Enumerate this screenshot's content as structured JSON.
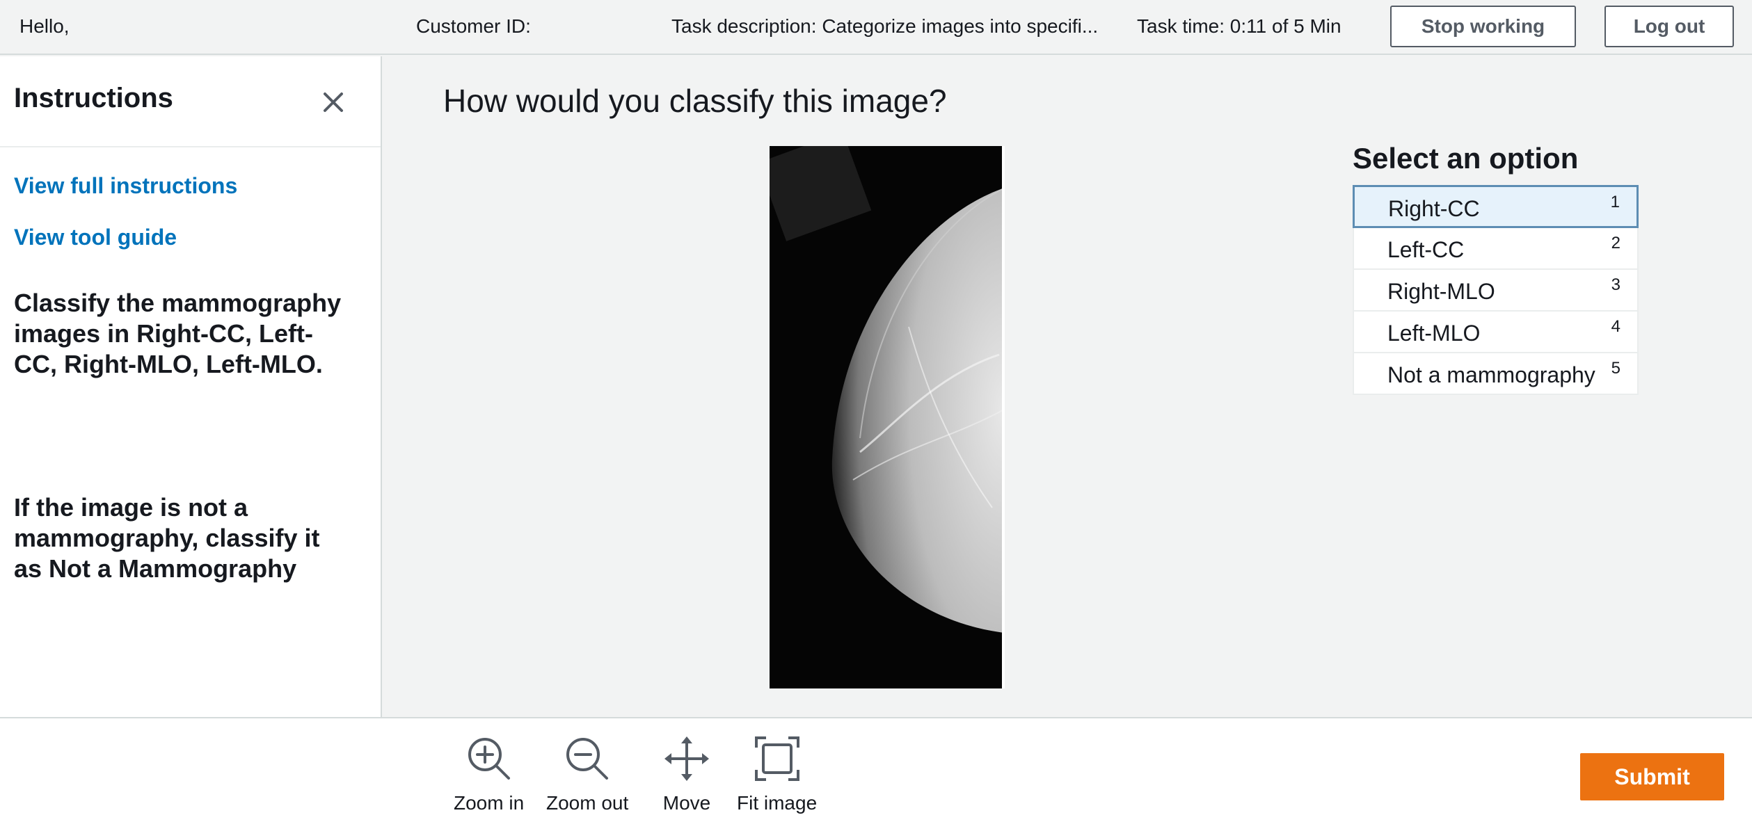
{
  "header": {
    "greeting": "Hello,",
    "customer_id_label": "Customer ID:",
    "task_description": "Task description: Categorize images into specifi...",
    "task_time": "Task time: 0:11 of 5 Min",
    "stop_button": "Stop working",
    "logout_button": "Log out"
  },
  "sidebar": {
    "title": "Instructions",
    "links": [
      "View full instructions",
      "View tool guide"
    ],
    "instruction_1": "Classify the mammography images in Right-CC, Left-CC, Right-MLO, Left-MLO.",
    "instruction_2": "If the image is not a mammography, classify it as Not a Mammography"
  },
  "main": {
    "question": "How would you classify this image?",
    "options_title": "Select an option",
    "options": [
      {
        "label": "Right-CC",
        "key": "1",
        "selected": true
      },
      {
        "label": "Left-CC",
        "key": "2",
        "selected": false
      },
      {
        "label": "Right-MLO",
        "key": "3",
        "selected": false
      },
      {
        "label": "Left-MLO",
        "key": "4",
        "selected": false
      },
      {
        "label": "Not a mammography",
        "key": "5",
        "selected": false
      }
    ]
  },
  "toolbar": {
    "tools": [
      {
        "label": "Zoom in",
        "icon": "zoom-in-icon"
      },
      {
        "label": "Zoom out",
        "icon": "zoom-out-icon"
      },
      {
        "label": "Move",
        "icon": "move-icon"
      },
      {
        "label": "Fit image",
        "icon": "fit-image-icon"
      }
    ],
    "submit_label": "Submit"
  },
  "colors": {
    "link": "#0073bb",
    "submit": "#ec7211",
    "selected_option_bg": "#e6f2fb",
    "selected_option_border": "#5d8db3"
  }
}
